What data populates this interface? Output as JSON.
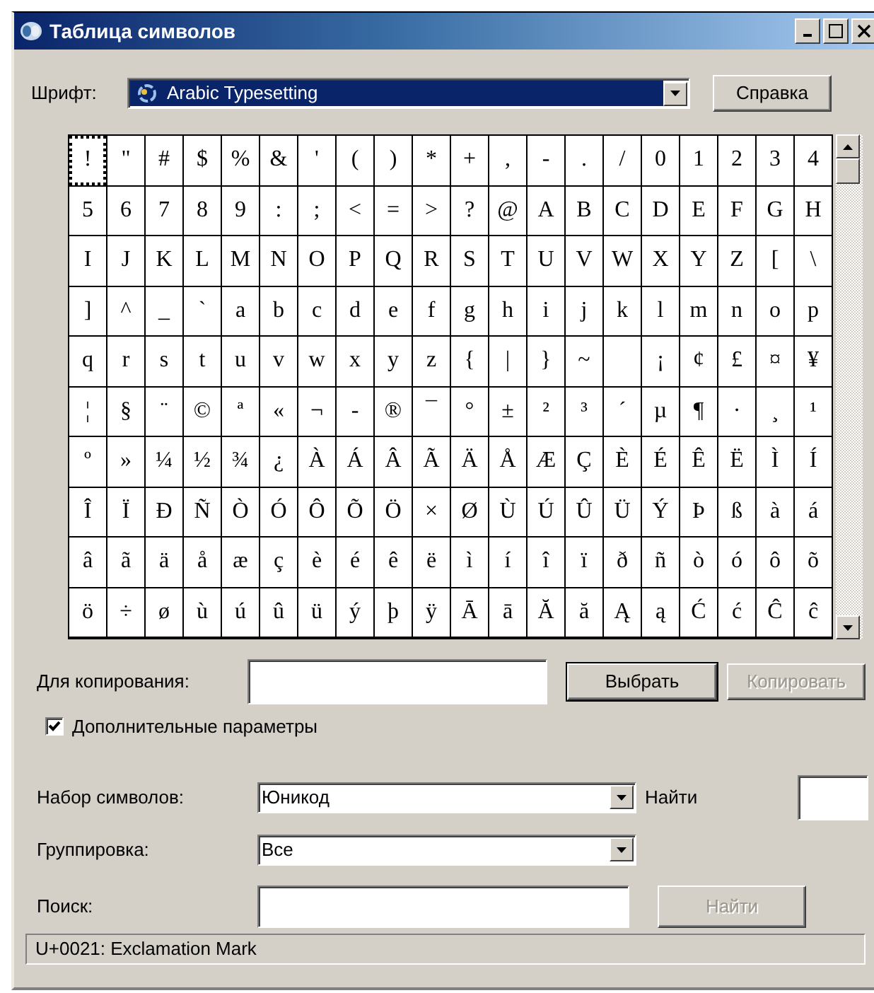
{
  "window": {
    "title": "Таблица символов"
  },
  "font": {
    "label": "Шрифт:",
    "value": "Arabic Typesetting"
  },
  "help_button": {
    "label": "Справка",
    "disabled": false
  },
  "grid": {
    "rows": [
      [
        {
          "char": "!",
          "selected": true
        },
        {
          "char": "\"",
          "selected": false
        },
        {
          "char": "#",
          "selected": false
        },
        {
          "char": "$",
          "selected": false
        },
        {
          "char": "%",
          "selected": false
        },
        {
          "char": "&",
          "selected": false
        },
        {
          "char": "'",
          "selected": false
        },
        {
          "char": "(",
          "selected": false
        },
        {
          "char": ")",
          "selected": false
        },
        {
          "char": "*",
          "selected": false
        },
        {
          "char": "+",
          "selected": false
        },
        {
          "char": ",",
          "selected": false
        },
        {
          "char": "-",
          "selected": false
        },
        {
          "char": ".",
          "selected": false
        },
        {
          "char": "/",
          "selected": false
        },
        {
          "char": "0",
          "selected": false
        },
        {
          "char": "1",
          "selected": false
        },
        {
          "char": "2",
          "selected": false
        },
        {
          "char": "3",
          "selected": false
        },
        {
          "char": "4",
          "selected": false
        }
      ],
      [
        {
          "char": "5",
          "selected": false
        },
        {
          "char": "6",
          "selected": false
        },
        {
          "char": "7",
          "selected": false
        },
        {
          "char": "8",
          "selected": false
        },
        {
          "char": "9",
          "selected": false
        },
        {
          "char": ":",
          "selected": false
        },
        {
          "char": ";",
          "selected": false
        },
        {
          "char": "<",
          "selected": false
        },
        {
          "char": "=",
          "selected": false
        },
        {
          "char": ">",
          "selected": false
        },
        {
          "char": "?",
          "selected": false
        },
        {
          "char": "@",
          "selected": false
        },
        {
          "char": "A",
          "selected": false
        },
        {
          "char": "B",
          "selected": false
        },
        {
          "char": "C",
          "selected": false
        },
        {
          "char": "D",
          "selected": false
        },
        {
          "char": "E",
          "selected": false
        },
        {
          "char": "F",
          "selected": false
        },
        {
          "char": "G",
          "selected": false
        },
        {
          "char": "H",
          "selected": false
        }
      ],
      [
        {
          "char": "I",
          "selected": false
        },
        {
          "char": "J",
          "selected": false
        },
        {
          "char": "K",
          "selected": false
        },
        {
          "char": "L",
          "selected": false
        },
        {
          "char": "M",
          "selected": false
        },
        {
          "char": "N",
          "selected": false
        },
        {
          "char": "O",
          "selected": false
        },
        {
          "char": "P",
          "selected": false
        },
        {
          "char": "Q",
          "selected": false
        },
        {
          "char": "R",
          "selected": false
        },
        {
          "char": "S",
          "selected": false
        },
        {
          "char": "T",
          "selected": false
        },
        {
          "char": "U",
          "selected": false
        },
        {
          "char": "V",
          "selected": false
        },
        {
          "char": "W",
          "selected": false
        },
        {
          "char": "X",
          "selected": false
        },
        {
          "char": "Y",
          "selected": false
        },
        {
          "char": "Z",
          "selected": false
        },
        {
          "char": "[",
          "selected": false
        },
        {
          "char": "\\",
          "selected": false
        }
      ],
      [
        {
          "char": "]",
          "selected": false
        },
        {
          "char": "^",
          "selected": false
        },
        {
          "char": "_",
          "selected": false
        },
        {
          "char": "`",
          "selected": false
        },
        {
          "char": "a",
          "selected": false
        },
        {
          "char": "b",
          "selected": false
        },
        {
          "char": "c",
          "selected": false
        },
        {
          "char": "d",
          "selected": false
        },
        {
          "char": "e",
          "selected": false
        },
        {
          "char": "f",
          "selected": false
        },
        {
          "char": "g",
          "selected": false
        },
        {
          "char": "h",
          "selected": false
        },
        {
          "char": "i",
          "selected": false
        },
        {
          "char": "j",
          "selected": false
        },
        {
          "char": "k",
          "selected": false
        },
        {
          "char": "l",
          "selected": false
        },
        {
          "char": "m",
          "selected": false
        },
        {
          "char": "n",
          "selected": false
        },
        {
          "char": "o",
          "selected": false
        },
        {
          "char": "p",
          "selected": false
        }
      ],
      [
        {
          "char": "q",
          "selected": false
        },
        {
          "char": "r",
          "selected": false
        },
        {
          "char": "s",
          "selected": false
        },
        {
          "char": "t",
          "selected": false
        },
        {
          "char": "u",
          "selected": false
        },
        {
          "char": "v",
          "selected": false
        },
        {
          "char": "w",
          "selected": false
        },
        {
          "char": "x",
          "selected": false
        },
        {
          "char": "y",
          "selected": false
        },
        {
          "char": "z",
          "selected": false
        },
        {
          "char": "{",
          "selected": false
        },
        {
          "char": "|",
          "selected": false
        },
        {
          "char": "}",
          "selected": false
        },
        {
          "char": "~",
          "selected": false
        },
        {
          "selected": false
        },
        {
          "char": "¡",
          "selected": false
        },
        {
          "char": "¢",
          "selected": false
        },
        {
          "char": "£",
          "selected": false
        },
        {
          "char": "¤",
          "selected": false
        },
        {
          "char": "¥",
          "selected": false
        }
      ],
      [
        {
          "char": "¦",
          "selected": false
        },
        {
          "char": "§",
          "selected": false
        },
        {
          "char": "¨",
          "selected": false
        },
        {
          "char": "©",
          "selected": false
        },
        {
          "char": "ª",
          "selected": false
        },
        {
          "char": "«",
          "selected": false
        },
        {
          "char": "¬",
          "selected": false
        },
        {
          "char": "-",
          "selected": false
        },
        {
          "char": "®",
          "selected": false
        },
        {
          "char": "¯",
          "selected": false
        },
        {
          "char": "°",
          "selected": false
        },
        {
          "char": "±",
          "selected": false
        },
        {
          "char": "²",
          "selected": false
        },
        {
          "char": "³",
          "selected": false
        },
        {
          "char": "´",
          "selected": false
        },
        {
          "char": "µ",
          "selected": false
        },
        {
          "char": "¶",
          "selected": false
        },
        {
          "char": "·",
          "selected": false
        },
        {
          "char": "¸",
          "selected": false
        },
        {
          "char": "¹",
          "selected": false
        }
      ],
      [
        {
          "char": "º",
          "selected": false
        },
        {
          "char": "»",
          "selected": false
        },
        {
          "char": "¼",
          "selected": false
        },
        {
          "char": "½",
          "selected": false
        },
        {
          "char": "¾",
          "selected": false
        },
        {
          "char": "¿",
          "selected": false
        },
        {
          "char": "À",
          "selected": false
        },
        {
          "char": "Á",
          "selected": false
        },
        {
          "char": "Â",
          "selected": false
        },
        {
          "char": "Ã",
          "selected": false
        },
        {
          "char": "Ä",
          "selected": false
        },
        {
          "char": "Å",
          "selected": false
        },
        {
          "char": "Æ",
          "selected": false
        },
        {
          "char": "Ç",
          "selected": false
        },
        {
          "char": "È",
          "selected": false
        },
        {
          "char": "É",
          "selected": false
        },
        {
          "char": "Ê",
          "selected": false
        },
        {
          "char": "Ë",
          "selected": false
        },
        {
          "char": "Ì",
          "selected": false
        },
        {
          "char": "Í",
          "selected": false
        }
      ],
      [
        {
          "char": "Î",
          "selected": false
        },
        {
          "char": "Ï",
          "selected": false
        },
        {
          "char": "Ð",
          "selected": false
        },
        {
          "char": "Ñ",
          "selected": false
        },
        {
          "char": "Ò",
          "selected": false
        },
        {
          "char": "Ó",
          "selected": false
        },
        {
          "char": "Ô",
          "selected": false
        },
        {
          "char": "Õ",
          "selected": false
        },
        {
          "char": "Ö",
          "selected": false
        },
        {
          "char": "×",
          "selected": false
        },
        {
          "char": "Ø",
          "selected": false
        },
        {
          "char": "Ù",
          "selected": false
        },
        {
          "char": "Ú",
          "selected": false
        },
        {
          "char": "Û",
          "selected": false
        },
        {
          "char": "Ü",
          "selected": false
        },
        {
          "char": "Ý",
          "selected": false
        },
        {
          "char": "Þ",
          "selected": false
        },
        {
          "char": "ß",
          "selected": false
        },
        {
          "char": "à",
          "selected": false
        },
        {
          "char": "á",
          "selected": false
        }
      ],
      [
        {
          "char": "â",
          "selected": false
        },
        {
          "char": "ã",
          "selected": false
        },
        {
          "char": "ä",
          "selected": false
        },
        {
          "char": "å",
          "selected": false
        },
        {
          "char": "æ",
          "selected": false
        },
        {
          "char": "ç",
          "selected": false
        },
        {
          "char": "è",
          "selected": false
        },
        {
          "char": "é",
          "selected": false
        },
        {
          "char": "ê",
          "selected": false
        },
        {
          "char": "ë",
          "selected": false
        },
        {
          "char": "ì",
          "selected": false
        },
        {
          "char": "í",
          "selected": false
        },
        {
          "char": "î",
          "selected": false
        },
        {
          "char": "ï",
          "selected": false
        },
        {
          "char": "ð",
          "selected": false
        },
        {
          "char": "ñ",
          "selected": false
        },
        {
          "char": "ò",
          "selected": false
        },
        {
          "char": "ó",
          "selected": false
        },
        {
          "char": "ô",
          "selected": false
        },
        {
          "char": "õ",
          "selected": false
        }
      ],
      [
        {
          "char": "ö",
          "selected": false
        },
        {
          "char": "÷",
          "selected": false
        },
        {
          "char": "ø",
          "selected": false
        },
        {
          "char": "ù",
          "selected": false
        },
        {
          "char": "ú",
          "selected": false
        },
        {
          "char": "û",
          "selected": false
        },
        {
          "char": "ü",
          "selected": false
        },
        {
          "char": "ý",
          "selected": false
        },
        {
          "char": "þ",
          "selected": false
        },
        {
          "char": "ÿ",
          "selected": false
        },
        {
          "char": "Ā",
          "selected": false
        },
        {
          "char": "ā",
          "selected": false
        },
        {
          "char": "Ă",
          "selected": false
        },
        {
          "char": "ă",
          "selected": false
        },
        {
          "char": "Ą",
          "selected": false
        },
        {
          "char": "ą",
          "selected": false
        },
        {
          "char": "Ć",
          "selected": false
        },
        {
          "char": "ć",
          "selected": false
        },
        {
          "char": "Ĉ",
          "selected": false
        },
        {
          "char": "ĉ",
          "selected": false
        }
      ]
    ]
  },
  "copy": {
    "label": "Для копирования:",
    "select_button": {
      "label": "Выбрать",
      "disabled": false
    },
    "copy_button": {
      "label": "Копировать",
      "disabled": true
    }
  },
  "advanced": {
    "label": "Дополнительные параметры",
    "checked": true
  },
  "charset": {
    "label": "Набор символов:",
    "value": "Юникод"
  },
  "goto": {
    "label": "Найти"
  },
  "grouping": {
    "label": "Группировка:",
    "value": "Все"
  },
  "search": {
    "label": "Поиск:",
    "button": {
      "label": "Найти",
      "disabled": true
    }
  },
  "status_bar": "U+0021: Exclamation Mark"
}
